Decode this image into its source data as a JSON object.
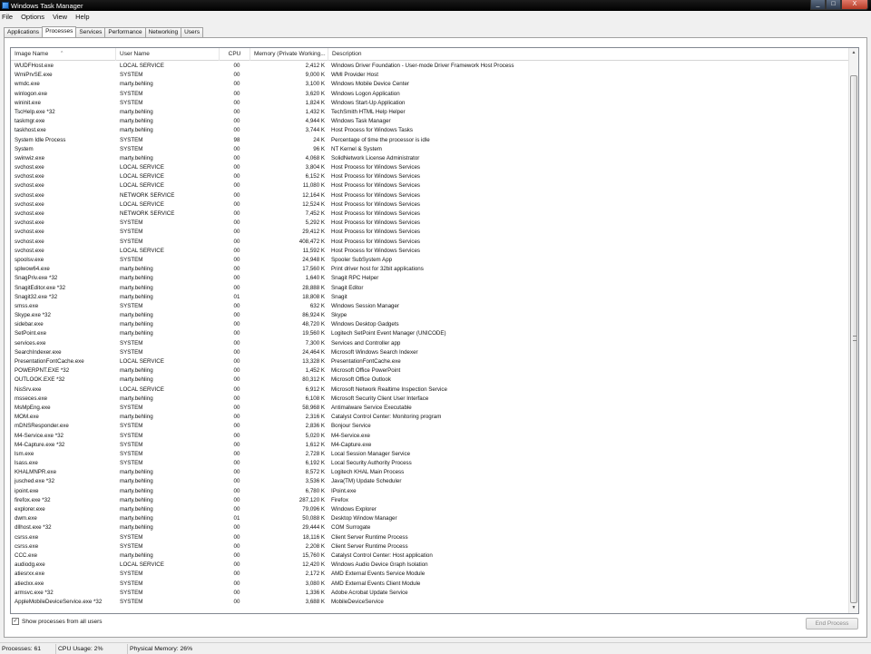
{
  "window": {
    "title": "Windows Task Manager"
  },
  "title_buttons": {
    "minimize": "_",
    "maximize": "□",
    "close": "X"
  },
  "menu": [
    "File",
    "Options",
    "View",
    "Help"
  ],
  "tabs": [
    "Applications",
    "Processes",
    "Services",
    "Performance",
    "Networking",
    "Users"
  ],
  "active_tab": "Processes",
  "columns": {
    "image_name": "Image Name",
    "user_name": "User Name",
    "cpu": "CPU",
    "memory": "Memory (Private Working...",
    "description": "Description"
  },
  "sort_indicator": "^",
  "processes": [
    [
      "WUDFHost.exe",
      "LOCAL SERVICE",
      "00",
      "2,412 K",
      "Windows Driver Foundation - User-mode Driver Framework Host Process"
    ],
    [
      "WmiPrvSE.exe",
      "SYSTEM",
      "00",
      "9,000 K",
      "WMI Provider Host"
    ],
    [
      "wmdc.exe",
      "marty.behling",
      "00",
      "3,100 K",
      "Windows Mobile Device Center"
    ],
    [
      "winlogon.exe",
      "SYSTEM",
      "00",
      "3,620 K",
      "Windows Logon Application"
    ],
    [
      "wininit.exe",
      "SYSTEM",
      "00",
      "1,824 K",
      "Windows Start-Up Application"
    ],
    [
      "TscHelp.exe *32",
      "marty.behling",
      "00",
      "1,432 K",
      "TechSmith HTML Help Helper"
    ],
    [
      "taskmgr.exe",
      "marty.behling",
      "00",
      "4,944 K",
      "Windows Task Manager"
    ],
    [
      "taskhost.exe",
      "marty.behling",
      "00",
      "3,744 K",
      "Host Process for Windows Tasks"
    ],
    [
      "System Idle Process",
      "SYSTEM",
      "98",
      "24 K",
      "Percentage of time the processor is idle"
    ],
    [
      "System",
      "SYSTEM",
      "00",
      "96 K",
      "NT Kernel & System"
    ],
    [
      "swinwiz.exe",
      "marty.behling",
      "00",
      "4,068 K",
      "SolidNetwork License Administrator"
    ],
    [
      "svchost.exe",
      "LOCAL SERVICE",
      "00",
      "3,804 K",
      "Host Process for Windows Services"
    ],
    [
      "svchost.exe",
      "LOCAL SERVICE",
      "00",
      "6,152 K",
      "Host Process for Windows Services"
    ],
    [
      "svchost.exe",
      "LOCAL SERVICE",
      "00",
      "11,080 K",
      "Host Process for Windows Services"
    ],
    [
      "svchost.exe",
      "NETWORK SERVICE",
      "00",
      "12,164 K",
      "Host Process for Windows Services"
    ],
    [
      "svchost.exe",
      "LOCAL SERVICE",
      "00",
      "12,524 K",
      "Host Process for Windows Services"
    ],
    [
      "svchost.exe",
      "NETWORK SERVICE",
      "00",
      "7,452 K",
      "Host Process for Windows Services"
    ],
    [
      "svchost.exe",
      "SYSTEM",
      "00",
      "5,292 K",
      "Host Process for Windows Services"
    ],
    [
      "svchost.exe",
      "SYSTEM",
      "00",
      "29,412 K",
      "Host Process for Windows Services"
    ],
    [
      "svchost.exe",
      "SYSTEM",
      "00",
      "408,472 K",
      "Host Process for Windows Services"
    ],
    [
      "svchost.exe",
      "LOCAL SERVICE",
      "00",
      "11,592 K",
      "Host Process for Windows Services"
    ],
    [
      "spoolsv.exe",
      "SYSTEM",
      "00",
      "24,948 K",
      "Spooler SubSystem App"
    ],
    [
      "splwow64.exe",
      "marty.behling",
      "00",
      "17,560 K",
      "Print driver host for 32bit applications"
    ],
    [
      "SnagPriv.exe *32",
      "marty.behling",
      "00",
      "1,640 K",
      "Snagit RPC Helper"
    ],
    [
      "SnagitEditor.exe *32",
      "marty.behling",
      "00",
      "28,888 K",
      "Snagit Editor"
    ],
    [
      "Snagit32.exe *32",
      "marty.behling",
      "01",
      "18,808 K",
      "Snagit"
    ],
    [
      "smss.exe",
      "SYSTEM",
      "00",
      "632 K",
      "Windows Session Manager"
    ],
    [
      "Skype.exe *32",
      "marty.behling",
      "00",
      "86,924 K",
      "Skype"
    ],
    [
      "sidebar.exe",
      "marty.behling",
      "00",
      "48,720 K",
      "Windows Desktop Gadgets"
    ],
    [
      "SetPoint.exe",
      "marty.behling",
      "00",
      "19,560 K",
      "Logitech SetPoint Event Manager (UNICODE)"
    ],
    [
      "services.exe",
      "SYSTEM",
      "00",
      "7,300 K",
      "Services and Controller app"
    ],
    [
      "SearchIndexer.exe",
      "SYSTEM",
      "00",
      "24,464 K",
      "Microsoft Windows Search Indexer"
    ],
    [
      "PresentationFontCache.exe",
      "LOCAL SERVICE",
      "00",
      "13,328 K",
      "PresentationFontCache.exe"
    ],
    [
      "POWERPNT.EXE *32",
      "marty.behling",
      "00",
      "1,452 K",
      "Microsoft Office PowerPoint"
    ],
    [
      "OUTLOOK.EXE *32",
      "marty.behling",
      "00",
      "80,312 K",
      "Microsoft Office Outlook"
    ],
    [
      "NisSrv.exe",
      "LOCAL SERVICE",
      "00",
      "6,912 K",
      "Microsoft Network Realtime Inspection Service"
    ],
    [
      "msseces.exe",
      "marty.behling",
      "00",
      "6,108 K",
      "Microsoft Security Client User Interface"
    ],
    [
      "MsMpEng.exe",
      "SYSTEM",
      "00",
      "58,968 K",
      "Antimalware Service Executable"
    ],
    [
      "MOM.exe",
      "marty.behling",
      "00",
      "2,316 K",
      "Catalyst Control Center: Monitoring program"
    ],
    [
      "mDNSResponder.exe",
      "SYSTEM",
      "00",
      "2,836 K",
      "Bonjour Service"
    ],
    [
      "M4-Service.exe *32",
      "SYSTEM",
      "00",
      "5,020 K",
      "M4-Service.exe"
    ],
    [
      "M4-Capture.exe *32",
      "SYSTEM",
      "00",
      "1,612 K",
      "M4-Capture.exe"
    ],
    [
      "lsm.exe",
      "SYSTEM",
      "00",
      "2,728 K",
      "Local Session Manager Service"
    ],
    [
      "lsass.exe",
      "SYSTEM",
      "00",
      "6,192 K",
      "Local Security Authority Process"
    ],
    [
      "KHALMNPR.exe",
      "marty.behling",
      "00",
      "8,572 K",
      "Logitech KHAL Main Process"
    ],
    [
      "jusched.exe *32",
      "marty.behling",
      "00",
      "3,536 K",
      "Java(TM) Update Scheduler"
    ],
    [
      "ipoint.exe",
      "marty.behling",
      "00",
      "6,780 K",
      "IPoint.exe"
    ],
    [
      "firefox.exe *32",
      "marty.behling",
      "00",
      "287,120 K",
      "Firefox"
    ],
    [
      "explorer.exe",
      "marty.behling",
      "00",
      "79,096 K",
      "Windows Explorer"
    ],
    [
      "dwm.exe",
      "marty.behling",
      "01",
      "50,088 K",
      "Desktop Window Manager"
    ],
    [
      "dllhost.exe *32",
      "marty.behling",
      "00",
      "29,444 K",
      "COM Surrogate"
    ],
    [
      "csrss.exe",
      "SYSTEM",
      "00",
      "18,116 K",
      "Client Server Runtime Process"
    ],
    [
      "csrss.exe",
      "SYSTEM",
      "00",
      "2,208 K",
      "Client Server Runtime Process"
    ],
    [
      "CCC.exe",
      "marty.behling",
      "00",
      "15,760 K",
      "Catalyst Control Center: Host application"
    ],
    [
      "audiodg.exe",
      "LOCAL SERVICE",
      "00",
      "12,420 K",
      "Windows Audio Device Graph Isolation"
    ],
    [
      "atiesrxx.exe",
      "SYSTEM",
      "00",
      "2,172 K",
      "AMD External Events Service Module"
    ],
    [
      "atieclxx.exe",
      "SYSTEM",
      "00",
      "3,080 K",
      "AMD External Events Client Module"
    ],
    [
      "armsvc.exe *32",
      "SYSTEM",
      "00",
      "1,336 K",
      "Adobe Acrobat Update Service"
    ],
    [
      "AppleMobileDeviceService.exe *32",
      "SYSTEM",
      "00",
      "3,688 K",
      "MobileDeviceService"
    ]
  ],
  "scrollbar": {
    "up": "▲",
    "down": "▼"
  },
  "show_all": {
    "label": "Show processes from all users",
    "checked": true,
    "check_mark": "✓"
  },
  "end_process_label": "End Process",
  "status": {
    "processes": "Processes: 61",
    "cpu": "CPU Usage: 2%",
    "memory": "Physical Memory: 26%"
  }
}
